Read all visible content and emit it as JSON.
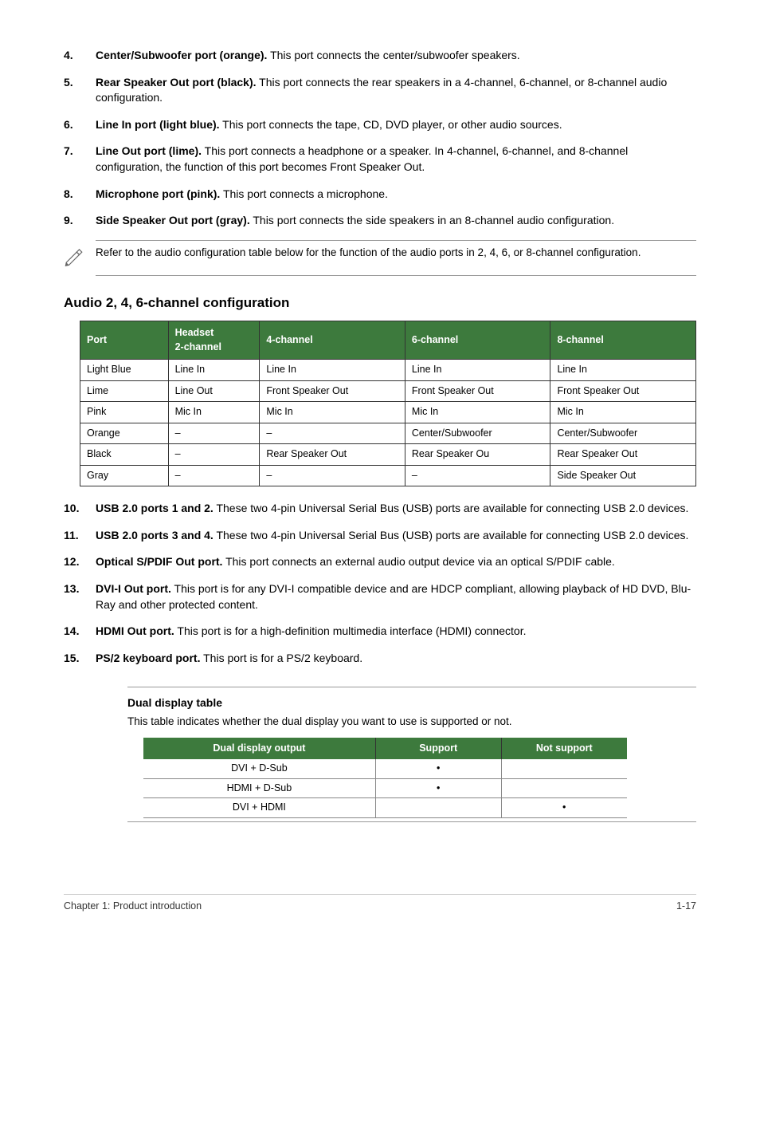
{
  "items_top": [
    {
      "num": "4.",
      "title": "Center/Subwoofer port (orange).",
      "text": " This port connects the center/subwoofer speakers."
    },
    {
      "num": "5.",
      "title": "Rear Speaker Out port (black).",
      "text": " This port connects the rear speakers in a 4-channel, 6-channel, or 8-channel audio configuration."
    },
    {
      "num": "6.",
      "title": "Line In port (light blue).",
      "text": " This port connects the tape, CD, DVD player, or other audio sources."
    },
    {
      "num": "7.",
      "title": "Line Out port (lime).",
      "text": " This port connects a headphone or a speaker. In 4-channel, 6-channel, and 8-channel configuration, the function of this port becomes Front Speaker Out."
    },
    {
      "num": "8.",
      "title": "Microphone port (pink).",
      "text": " This port connects a microphone."
    },
    {
      "num": "9.",
      "title": "Side Speaker Out port (gray).",
      "text": " This port connects the side speakers in an 8-channel audio configuration."
    }
  ],
  "note_text": "Refer to the audio configuration table below for the function of the audio ports in 2, 4, 6, or 8-channel configuration.",
  "audio_heading": "Audio 2, 4, 6-channel configuration",
  "audio_table": {
    "headers": {
      "c0": "Port",
      "c1_l1": "Headset",
      "c1_l2": "2-channel",
      "c2": "4-channel",
      "c3": "6-channel",
      "c4": "8-channel"
    },
    "rows": [
      [
        "Light Blue",
        "Line In",
        "Line In",
        "Line In",
        "Line In"
      ],
      [
        "Lime",
        "Line Out",
        "Front Speaker Out",
        "Front Speaker Out",
        "Front Speaker Out"
      ],
      [
        "Pink",
        "Mic In",
        "Mic In",
        "Mic In",
        "Mic In"
      ],
      [
        "Orange",
        "–",
        "–",
        "Center/Subwoofer",
        "Center/Subwoofer"
      ],
      [
        "Black",
        "–",
        "Rear Speaker Out",
        "Rear Speaker Ou",
        "Rear Speaker Out"
      ],
      [
        "Gray",
        "–",
        "–",
        "–",
        "Side Speaker Out"
      ]
    ]
  },
  "items_bottom": [
    {
      "num": "10.",
      "title": "USB 2.0 ports 1 and 2.",
      "text": " These two 4-pin Universal Serial Bus (USB) ports are available for connecting USB 2.0 devices."
    },
    {
      "num": "11.",
      "title": "USB 2.0 ports 3 and 4.",
      "text": " These two 4-pin Universal Serial Bus (USB) ports are available for connecting USB 2.0 devices."
    },
    {
      "num": "12.",
      "title": "Optical S/PDIF Out port.",
      "text": " This port connects an external audio output device via an optical S/PDIF cable."
    },
    {
      "num": "13.",
      "title": "DVI-I Out port.",
      "text": " This port is for any DVI-I compatible device and are HDCP compliant, allowing playback of HD DVD, Blu-Ray and other protected content."
    },
    {
      "num": "14.",
      "title": "HDMI Out port.",
      "text": " This port is for a high-definition multimedia interface (HDMI) connector."
    },
    {
      "num": "15.",
      "title": "PS/2 keyboard port.",
      "text": " This port is for a PS/2 keyboard."
    }
  ],
  "dual": {
    "title": "Dual display table",
    "desc": "This table indicates whether the dual display you want to use is supported or not.",
    "headers": [
      "Dual display output",
      "Support",
      "Not support"
    ],
    "rows": [
      [
        "DVI + D-Sub",
        "•",
        ""
      ],
      [
        "HDMI + D-Sub",
        "•",
        ""
      ],
      [
        "DVI + HDMI",
        "",
        "•"
      ]
    ]
  },
  "footer": {
    "left": "Chapter 1: Product introduction",
    "right": "1-17"
  }
}
